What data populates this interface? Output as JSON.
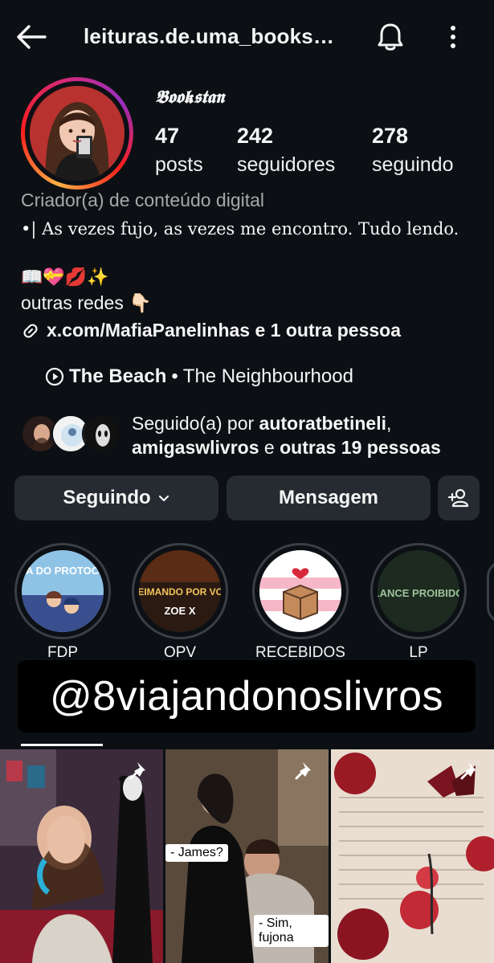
{
  "header": {
    "username": "leituras.de.uma_books…",
    "icons": [
      "back-arrow-icon",
      "bell-icon",
      "more-vertical-icon"
    ]
  },
  "profile": {
    "display_name": "𝕭𝖔𝖔𝖐𝖘𝖙𝖆𝖓",
    "stats": [
      {
        "value": "47",
        "label": "posts"
      },
      {
        "value": "242",
        "label": "seguidores"
      },
      {
        "value": "278",
        "label": "seguindo"
      }
    ],
    "category": "Criador(a) de conteúdo digital",
    "bio_line1": "•| As vezes fujo, as vezes me encontro. Tudo lendo.",
    "bio_emojis": "📖💝💋✨",
    "other_networks": "outras redes 👇🏻",
    "link_text": "x.com/MafiaPanelinhas e 1 outra pessoa",
    "music": {
      "song": "The Beach",
      "separator": " • ",
      "artist": "The Neighbourhood"
    }
  },
  "followed_by": {
    "prefix": "Seguido(a) por ",
    "user1": "autoratbetineli",
    "comma": ",",
    "user2": "amigaswlivros",
    "middle": " e ",
    "rest": "outras 19 pessoas"
  },
  "actions": {
    "following_label": "Seguindo",
    "message_label": "Mensagem"
  },
  "highlights": [
    {
      "label": "FDP",
      "cover_text": "FORA DO PROTOCOLO"
    },
    {
      "label": "OPV",
      "cover_text": "QUEIMANDO POR VOCÊ",
      "cover_author": "ZOE X"
    },
    {
      "label": "RECEBIDOS"
    },
    {
      "label": "LP",
      "cover_text": "LANCE PROIBIDO"
    }
  ],
  "overlay_handle": "@8viajandonoslivros",
  "posts": [
    {
      "pinned": true
    },
    {
      "pinned": true,
      "caption1": "- James?",
      "caption2": "- Sim, fujona"
    },
    {
      "pinned": true
    }
  ],
  "colors": {
    "background": "#0c1014",
    "button": "#262b31",
    "muted_text": "#a8a8a8"
  }
}
